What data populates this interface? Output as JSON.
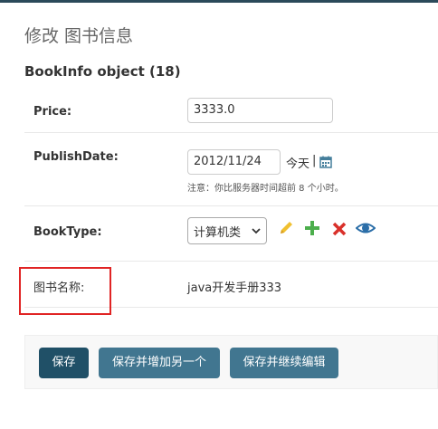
{
  "page": {
    "title": "修改 图书信息",
    "object_title": "BookInfo object (18)"
  },
  "form": {
    "price": {
      "label": "Price:",
      "value": "3333.0"
    },
    "publish_date": {
      "label": "PublishDate:",
      "value": "2012/11/24",
      "today_link": "今天",
      "separator": "|",
      "note": "注意：你比服务器时间超前 8 个小时。"
    },
    "book_type": {
      "label": "BookType:",
      "selected": "计算机类"
    },
    "book_name": {
      "label": "图书名称:",
      "value": "java开发手册333"
    }
  },
  "buttons": {
    "save": "保存",
    "save_add_another": "保存并增加另一个",
    "save_continue": "保存并继续编辑"
  },
  "colors": {
    "primary_button": "#205067",
    "secondary_button": "#417690",
    "edit_icon": "#f0c030",
    "add_icon": "#4cae4c",
    "delete_icon": "#d9302a",
    "view_icon": "#2b6ea8",
    "highlight": "#e02424"
  }
}
